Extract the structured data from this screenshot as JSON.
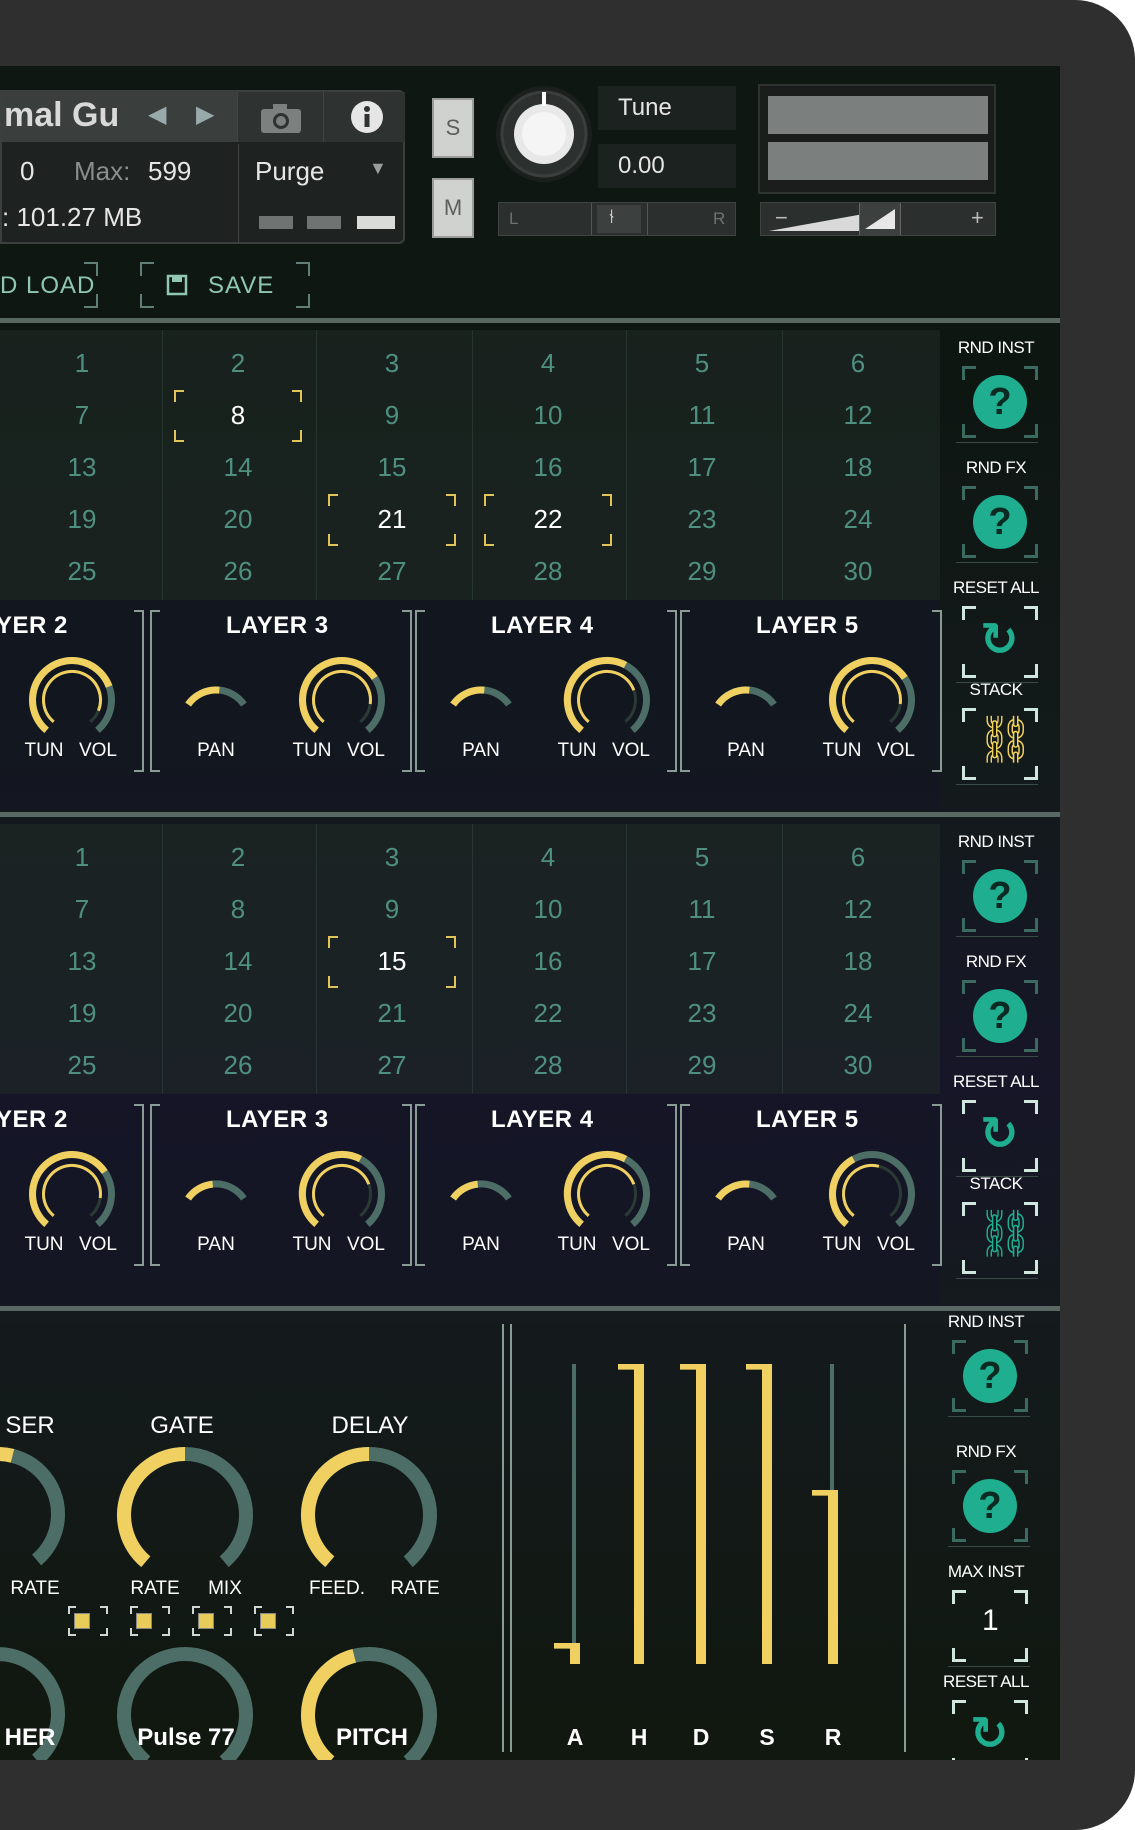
{
  "header": {
    "instrument_name": "mal Gu",
    "midi_ch": "0",
    "max_label": "Max:",
    "max_value": "599",
    "memory": ": 101.27 MB",
    "purge_label": "Purge",
    "solo_label": "S",
    "mute_label": "M",
    "tune_label": "Tune",
    "tune_value": "0.00",
    "pan_left": "L",
    "pan_right": "R",
    "vol_minus": "−",
    "vol_plus": "+"
  },
  "toolbar": {
    "load_label": "D LOAD",
    "save_label": "SAVE"
  },
  "panels": [
    {
      "grid": [
        "1",
        "2",
        "3",
        "4",
        "5",
        "6",
        "7",
        "8",
        "9",
        "10",
        "11",
        "12",
        "13",
        "14",
        "15",
        "16",
        "17",
        "18",
        "19",
        "20",
        "21",
        "22",
        "23",
        "24",
        "25",
        "26",
        "27",
        "28",
        "29",
        "30"
      ],
      "selected": [
        "8",
        "21",
        "22"
      ],
      "layers": [
        {
          "title": "YER 2",
          "knobs": [
            "TUN",
            "VOL"
          ],
          "tun": 0.75,
          "vol": 0.3
        },
        {
          "title": "LAYER 3",
          "knobs": [
            "PAN",
            "TUN",
            "VOL"
          ],
          "pan": 0.3,
          "tun": 0.7,
          "vol": 0.2
        },
        {
          "title": "LAYER 4",
          "knobs": [
            "PAN",
            "TUN",
            "VOL"
          ],
          "pan": 0.3,
          "tun": 0.6,
          "vol": 0.2
        },
        {
          "title": "LAYER 5",
          "knobs": [
            "PAN",
            "TUN",
            "VOL"
          ],
          "pan": 0.3,
          "tun": 0.7,
          "vol": 0.2
        }
      ],
      "side": {
        "rnd_inst": "RND INST",
        "rnd_fx": "RND FX",
        "reset_all": "RESET ALL",
        "stack": "STACK",
        "stack_on": true
      }
    },
    {
      "grid": [
        "1",
        "2",
        "3",
        "4",
        "5",
        "6",
        "7",
        "8",
        "9",
        "10",
        "11",
        "12",
        "13",
        "14",
        "15",
        "16",
        "17",
        "18",
        "19",
        "20",
        "21",
        "22",
        "23",
        "24",
        "25",
        "26",
        "27",
        "28",
        "29",
        "30"
      ],
      "selected": [
        "15"
      ],
      "layers": [
        {
          "title": "YER 2",
          "knobs": [
            "TUN",
            "VOL"
          ],
          "tun": 0.7,
          "vol": 0.3
        },
        {
          "title": "LAYER 3",
          "knobs": [
            "PAN",
            "TUN",
            "VOL"
          ],
          "pan": 0.2,
          "tun": 0.6,
          "vol": 0.2
        },
        {
          "title": "LAYER 4",
          "knobs": [
            "PAN",
            "TUN",
            "VOL"
          ],
          "pan": 0.2,
          "tun": 0.6,
          "vol": 0.2
        },
        {
          "title": "LAYER 5",
          "knobs": [
            "PAN",
            "TUN",
            "VOL"
          ],
          "pan": 0.3,
          "tun": 0.4,
          "vol": 0.2
        }
      ],
      "side": {
        "rnd_inst": "RND INST",
        "rnd_fx": "RND FX",
        "reset_all": "RESET ALL",
        "stack": "STACK",
        "stack_on": false
      }
    }
  ],
  "fx": {
    "titles": [
      "SER",
      "GATE",
      "DELAY"
    ],
    "small_labels": [
      "RATE",
      "RATE",
      "MIX",
      "FEED.",
      "RATE"
    ],
    "bottom_labels": [
      "HER",
      "Pulse 77",
      "PITCH"
    ],
    "adsr": [
      "A",
      "H",
      "D",
      "S",
      "R"
    ],
    "adsr_values": [
      0.07,
      1.0,
      1.0,
      1.0,
      0.58
    ],
    "side": {
      "rnd_inst": "RND INST",
      "rnd_fx": "RND FX",
      "max_inst": "MAX INST",
      "max_inst_value": "1",
      "reset_all": "RESET ALL"
    }
  },
  "colors": {
    "accent": "#f0d060",
    "teal": "#1fae8f",
    "track": "#4d6e66"
  }
}
